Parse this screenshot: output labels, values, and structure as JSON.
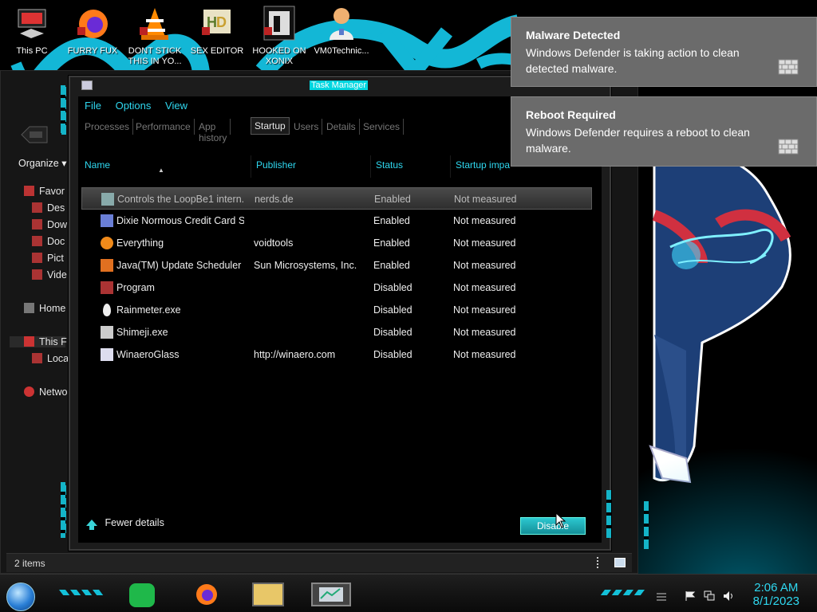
{
  "desktop": {
    "icons": [
      {
        "label": "This PC"
      },
      {
        "label": "FURRY FUX"
      },
      {
        "label": "DONT STICK THIS IN YO..."
      },
      {
        "label": "SEX EDITOR"
      },
      {
        "label": "HOOKED ON XONIX"
      },
      {
        "label": "VM0Technic..."
      }
    ]
  },
  "explorer": {
    "organize": "Organize",
    "nav": [
      {
        "label": "Favor"
      },
      {
        "label": "Des"
      },
      {
        "label": "Dow"
      },
      {
        "label": "Doc"
      },
      {
        "label": "Pict"
      },
      {
        "label": "Vide"
      },
      {
        "label": "Home"
      },
      {
        "label": "This F"
      },
      {
        "label": "Loca"
      },
      {
        "label": "Netwo"
      }
    ],
    "status": "2 items"
  },
  "task_manager": {
    "title": "Task Manager",
    "menu": [
      "File",
      "Options",
      "View"
    ],
    "tabs": [
      "Processes",
      "Performance",
      "App history",
      "Startup",
      "Users",
      "Details",
      "Services"
    ],
    "active_tab": "Startup",
    "columns": [
      "Name",
      "Publisher",
      "Status",
      "Startup impa"
    ],
    "rows": [
      {
        "name": "Controls the LoopBe1 intern...",
        "publisher": "nerds.de",
        "status": "Enabled",
        "impact": "Not measured",
        "icon": "loopbe-icon",
        "selected": true
      },
      {
        "name": "Dixie Normous Credit Card S...",
        "publisher": "",
        "status": "Enabled",
        "impact": "Not measured",
        "icon": "card-icon"
      },
      {
        "name": "Everything",
        "publisher": "voidtools",
        "status": "Enabled",
        "impact": "Not measured",
        "icon": "search-icon"
      },
      {
        "name": "Java(TM) Update Scheduler",
        "publisher": "Sun Microsystems, Inc.",
        "status": "Enabled",
        "impact": "Not measured",
        "icon": "java-icon"
      },
      {
        "name": "Program",
        "publisher": "",
        "status": "Disabled",
        "impact": "Not measured",
        "icon": "program-icon"
      },
      {
        "name": "Rainmeter.exe",
        "publisher": "",
        "status": "Disabled",
        "impact": "Not measured",
        "icon": "raindrop-icon"
      },
      {
        "name": "Shimeji.exe",
        "publisher": "",
        "status": "Disabled",
        "impact": "Not measured",
        "icon": "shimeji-icon"
      },
      {
        "name": "WinaeroGlass",
        "publisher": "http://winaero.com",
        "status": "Disabled",
        "impact": "Not measured",
        "icon": "window-icon"
      }
    ],
    "fewer_details": "Fewer details",
    "disable_button": "Disable"
  },
  "notifications": [
    {
      "title": "Malware Detected",
      "body": "Windows Defender is taking action to clean detected malware."
    },
    {
      "title": "Reboot Required",
      "body": "Windows Defender requires a reboot to clean malware."
    }
  ],
  "taskbar": {
    "time": "2:06 AM",
    "date": "8/1/2023"
  },
  "colors": {
    "accent": "#2fd8f0",
    "toast": "#6b6b6b",
    "button": "#1fb0bc"
  }
}
